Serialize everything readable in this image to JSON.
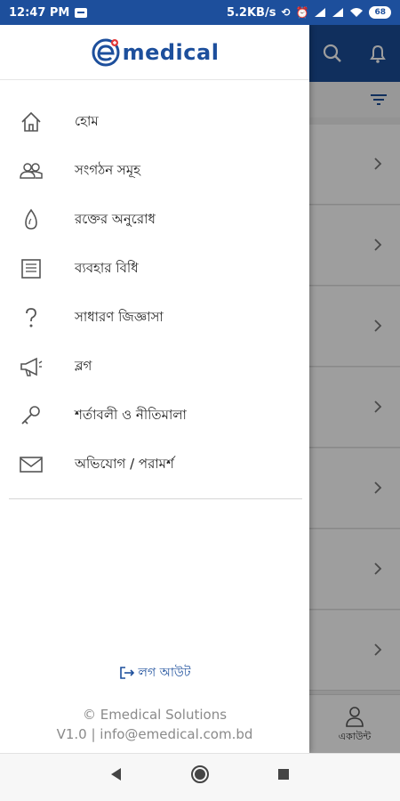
{
  "status_bar": {
    "time": "12:47 PM",
    "speed": "5.2KB/s",
    "battery": "68"
  },
  "app": {
    "logo_text": "medical",
    "account_label": "একাউন্ট"
  },
  "drawer": {
    "items": [
      {
        "icon": "home-icon",
        "label": "হোম"
      },
      {
        "icon": "group-icon",
        "label": "সংগঠন সমূহ"
      },
      {
        "icon": "blood-drop-icon",
        "label": "রক্তের অনুরোধ"
      },
      {
        "icon": "document-icon",
        "label": "ব্যবহার বিধি"
      },
      {
        "icon": "question-icon",
        "label": "সাধারণ জিজ্ঞাসা"
      },
      {
        "icon": "megaphone-icon",
        "label": "ব্লগ"
      },
      {
        "icon": "key-icon",
        "label": "শর্তাবলী ও নীতিমালা"
      },
      {
        "icon": "mail-icon",
        "label": "অভিযোগ / পরামর্শ"
      }
    ],
    "logout_label": "লগ আউট",
    "footer_line1": "© Emedical Solutions",
    "footer_line2": "V1.0 | info@emedical.com.bd"
  },
  "colors": {
    "brand": "#1d4f9c",
    "header": "#1b4d96"
  }
}
